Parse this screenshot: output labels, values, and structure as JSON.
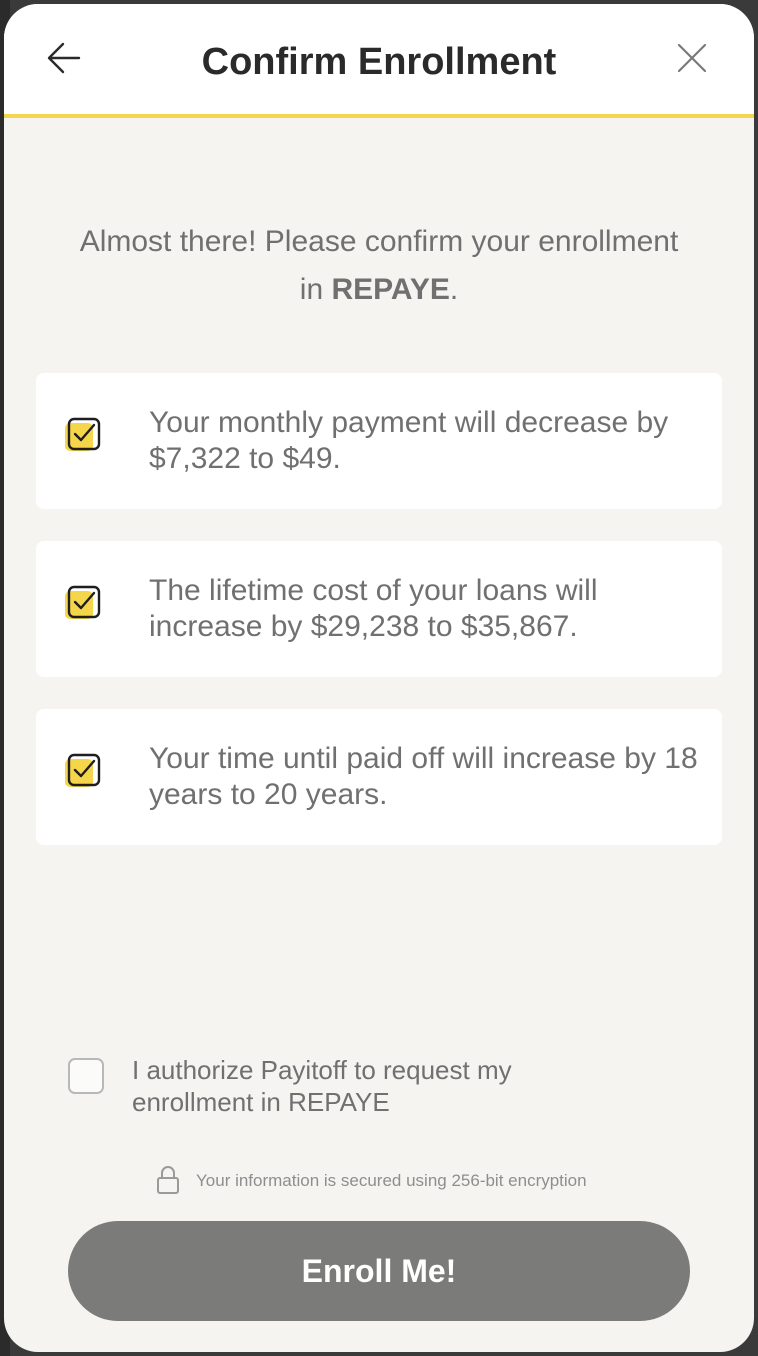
{
  "header": {
    "title": "Confirm Enrollment",
    "back_icon": "arrow-left-icon",
    "close_icon": "close-icon"
  },
  "intro": {
    "prefix": "Almost there! Please confirm your enrollment in ",
    "plan": "REPAYE",
    "suffix": "."
  },
  "items": [
    {
      "text": "Your monthly payment will decrease by $7,322 to $49.",
      "checked": true
    },
    {
      "text": "The lifetime cost of your loans will increase by $29,238 to $35,867.",
      "checked": true
    },
    {
      "text": "Your time until paid off will increase by 18 years to 20 years.",
      "checked": true
    }
  ],
  "authorization": {
    "label": "I authorize Payitoff to request my enrollment in REPAYE",
    "checked": false
  },
  "security": {
    "text": "Your information is secured using 256-bit encryption",
    "icon": "lock-icon"
  },
  "submit": {
    "label": "Enroll Me!"
  },
  "colors": {
    "accent": "#f3d64d",
    "button": "#7b7b79",
    "text": "#707070",
    "background": "#f5f4f1"
  }
}
